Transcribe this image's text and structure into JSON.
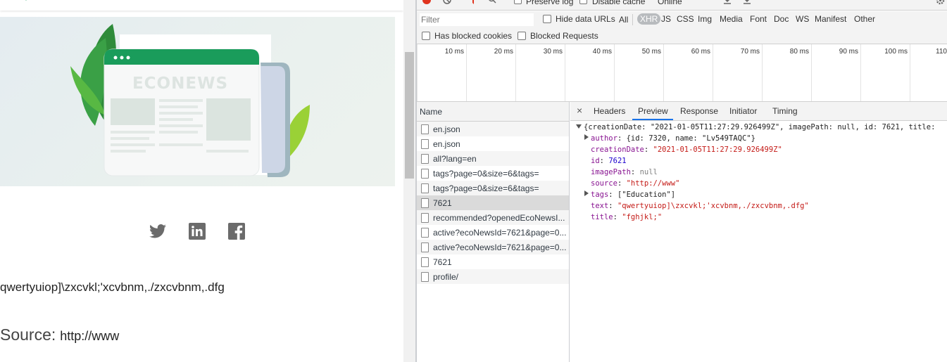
{
  "page": {
    "hero_title": "ECONEWS",
    "article_text": "qwertyuiop]\\zxcvkl;'xcvbnm,./zxcvbnm,.dfg",
    "source_label": "Source:",
    "source_value": "http://www"
  },
  "devtools": {
    "toolbar": {
      "preserve_log": "Preserve log",
      "disable_cache": "Disable cache",
      "throttle": "Online"
    },
    "filter": {
      "placeholder": "Filter",
      "hide_data_urls": "Hide data URLs",
      "types": [
        "All",
        "XHR",
        "JS",
        "CSS",
        "Img",
        "Media",
        "Font",
        "Doc",
        "WS",
        "Manifest",
        "Other"
      ],
      "active_type": "XHR",
      "has_blocked_cookies": "Has blocked cookies",
      "blocked_requests": "Blocked Requests"
    },
    "timeline_ticks": [
      "10 ms",
      "20 ms",
      "30 ms",
      "40 ms",
      "50 ms",
      "60 ms",
      "70 ms",
      "80 ms",
      "90 ms",
      "100 ms",
      "110"
    ],
    "requests": {
      "header": "Name",
      "items": [
        "en.json",
        "en.json",
        "all?lang=en",
        "tags?page=0&size=6&tags=",
        "tags?page=0&size=6&tags=",
        "7621",
        "recommended?openedEcoNewsI...",
        "active?ecoNewsId=7621&page=0...",
        "active?ecoNewsId=7621&page=0...",
        "7621",
        "profile/"
      ],
      "selected_index": 5
    },
    "detail_tabs": [
      "Headers",
      "Preview",
      "Response",
      "Initiator",
      "Timing"
    ],
    "active_tab": "Preview",
    "preview": {
      "summary": "{creationDate: \"2021-01-05T11:27:29.926499Z\", imagePath: null, id: 7621, title:",
      "author_key": "author",
      "author_val": "{id: 7320, name: \"Lv549TAQC\"}",
      "creationDate_key": "creationDate",
      "creationDate_val": "\"2021-01-05T11:27:29.926499Z\"",
      "id_key": "id",
      "id_val": "7621",
      "imagePath_key": "imagePath",
      "imagePath_val": "null",
      "source_key": "source",
      "source_val": "\"http://www\"",
      "tags_key": "tags",
      "tags_val": "[\"Education\"]",
      "text_key": "text",
      "text_val": "\"qwertyuiop]\\zxcvkl;'xcvbnm,./zxcvbnm,.dfg\"",
      "title_key": "title",
      "title_val": "\"fghjkl;\""
    }
  },
  "colors": {
    "accent_green": "#1a9c5b",
    "xhr_pill": "#b8bbbe",
    "tab_underline": "#1a73e8",
    "string": "#c41a16",
    "key": "#881391",
    "number": "#1c00cf"
  }
}
